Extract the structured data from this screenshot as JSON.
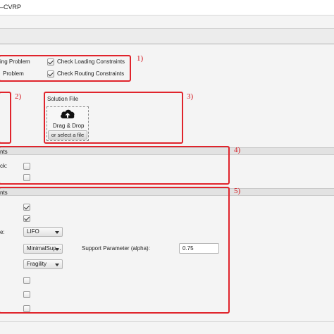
{
  "window": {
    "title": "–CVRP"
  },
  "problem_group": {
    "loading_problem": "ing Problem",
    "routing_problem": "Problem",
    "check_loading": "Check Loading Constraints",
    "check_routing": "Check Routing Constraints",
    "check_loading_checked": true,
    "check_routing_checked": true
  },
  "solution": {
    "label": "Solution File",
    "drag_drop": "Drag & Drop",
    "select_file": "or select a file",
    "icon": "cloud-upload-icon"
  },
  "section4": {
    "header": "nts",
    "row1_label": "ck:",
    "row1_checked": false,
    "row2_checked": false
  },
  "section5": {
    "header": "nts",
    "row1_checked": true,
    "row2_checked": true,
    "row3_label": "e:",
    "row3_value": "LIFO",
    "row4_value": "MinimalSup...",
    "support_label": "Support Parameter (alpha):",
    "support_value": "0.75",
    "row5_value": "Fragility",
    "row6_checked": false,
    "row7_checked": false,
    "row8_checked": false
  },
  "annotations": [
    "1)",
    "2)",
    "3)",
    "4)",
    "5)"
  ],
  "colors": {
    "annotation_red": "#e0242c",
    "background": "#f4f4f4"
  }
}
